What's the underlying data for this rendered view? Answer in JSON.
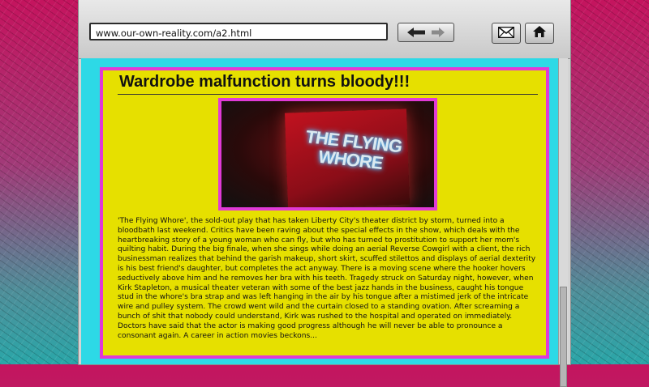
{
  "browser": {
    "url": "www.our-own-reality.com/a2.html",
    "nav_icons": [
      "back-arrow-icon",
      "forward-arrow-icon"
    ],
    "mail_icon": "envelope-icon",
    "home_icon": "home-icon"
  },
  "page": {
    "headline": "Wardrobe malfunction turns bloody!!!",
    "photo_text": "THE FLYING WHORE",
    "article": "'The Flying Whore', the sold-out play that has taken Liberty City's theater district by storm, turned into a bloodbath last weekend.  Critics have been raving about the special effects in the show, which deals with the heartbreaking story of a young woman who can fly, but who has turned to prostitution to support her mom's quilting habit.  During the big finale, when she sings while doing an aerial Reverse Cowgirl with a client, the rich businessman realizes that behind the garish makeup, short skirt, scuffed stilettos and displays of aerial dexterity is his best friend's daughter, but completes the act anyway.  There is a moving scene where the hooker hovers seductively above him and he removes her bra with his teeth.  Tragedy struck on Saturday night, however, when Kirk Stapleton, a musical theater veteran with some of the best jazz hands in the business, caught his tongue stud in the whore's bra strap and was left hanging in the air by his tongue after a mistimed jerk of the intricate wire and pulley system.  The crowd went wild and the curtain closed to a standing ovation.  After screaming a bunch of shit that nobody could understand, Kirk was rushed to the hospital and operated on immediately.  Doctors have said that the actor is making good progress although he will never be able to pronounce a consonant again.  A career in action movies beckons..."
  },
  "colors": {
    "page_background": "#2dd9e6",
    "card_background": "#e6e000",
    "card_border": "#e03ad6"
  }
}
